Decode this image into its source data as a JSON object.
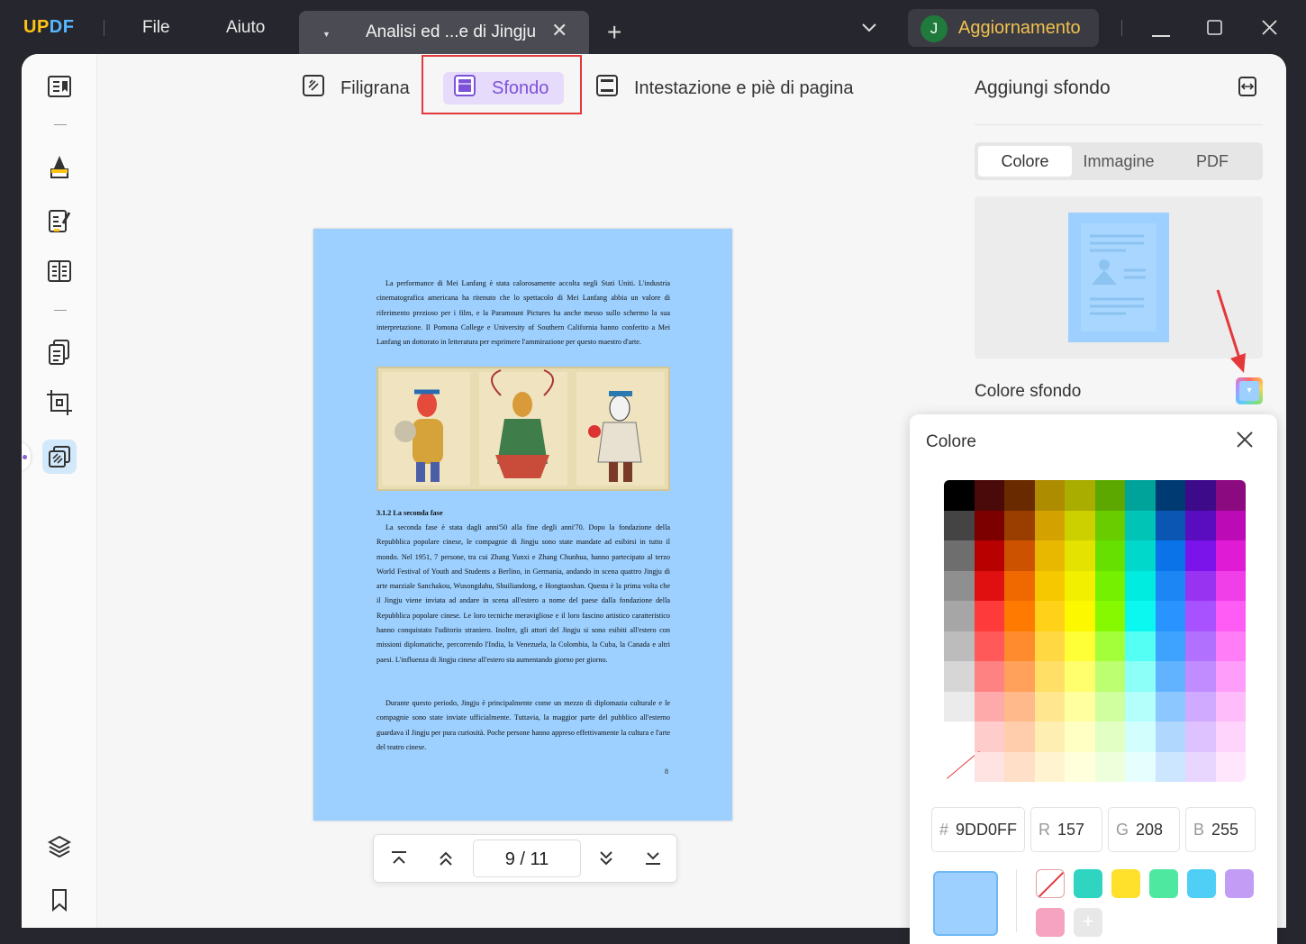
{
  "app": {
    "logo_u": "UP",
    "logo_df": "DF"
  },
  "menu": {
    "file": "File",
    "help": "Aiuto"
  },
  "tab": {
    "title": "Analisi ed ...e di Jingju",
    "close": "✕",
    "new": "+"
  },
  "account": {
    "avatar": "J",
    "upgrade": "Aggiornamento"
  },
  "toolbar": {
    "watermark": "Filigrana",
    "background": "Sfondo",
    "header_footer": "Intestazione e piè di pagina"
  },
  "document": {
    "para1": "La performance di Mei Lanfang è stata calorosamente accolta negli Stati Uniti. L'industria cinematografica americana ha ritenuto che lo spettacolo di Mei Lanfang abbia un valore di riferimento prezioso per i film, e la Paramount Pictures ha anche messo sullo schermo la sua interpretazione. Il Pomona College e University of Southern California hanno conferito a Mei Lanfang un dottorato in letteratura per esprimere l'ammirazione per questo maestro d'arte.",
    "heading": "3.1.2 La seconda fase",
    "para2": "La seconda fase è stata dagli anni'50 alla fine degli anni'70. Dopo la fondazione della Repubblica popolare cinese, le compagnie di Jingju sono state mandate ad esibirsi in tutto il mondo. Nel 1951, 7 persone, tra cui Zhang Yunxi e Zhang Chunhua, hanno partecipato al terzo World Festival of Youth and Students a Berlino, in Germania, andando in scena quattro Jingju di arte marziale Sanchakou, Wusongdahu, Shuiliandong, e Hongtaoshan. Questa è la prima volta che il Jingju viene inviata ad andare in scena all'estero a nome del paese dalla fondazione della Repubblica popolare cinese. Le loro tecniche meravigliose e il loro fascino artistico caratteristico hanno conquistato l'uditorio straniero. Inoltre, gli attori del Jingju si sono esibiti all'estero con missioni diplomatiche, percorrendo l'India, la Venezuela, la Colombia, la Cuba, la Canada e altri paesi. L'influenza di Jingju cinese all'estero sta aumentando giorno per giorno.",
    "para3": "Durante questo periodo, Jingju è principalmente come un mezzo di diplomazia culturale e le compagnie sono state inviate ufficialmente. Tuttavia, la maggior parte del pubblico all'esterno guardava il Jingju per pura curiosità. Poche persone hanno appreso effettivamente la cultura e l'arte del teatro cinese.",
    "page_number": "8",
    "background_color": "#9DD0FF"
  },
  "pager": {
    "current": "9",
    "separator": "/",
    "total": "11"
  },
  "panel": {
    "title": "Aggiungi sfondo",
    "tabs": [
      "Colore",
      "Immagine",
      "PDF"
    ],
    "active_tab": "Colore",
    "bg_color_label": "Colore sfondo"
  },
  "color_picker": {
    "title": "Colore",
    "hex_prefix": "#",
    "hex": "9DD0FF",
    "r_label": "R",
    "r": "157",
    "g_label": "G",
    "g": "208",
    "b_label": "B",
    "b": "255",
    "selected": "#9DD0FF",
    "palette": [
      [
        "#000000",
        "#4b0a0a",
        "#6a2a00",
        "#ad8c00",
        "#a8ad00",
        "#5da800",
        "#00a39a",
        "#003a73",
        "#3d0a8a",
        "#8c0a80"
      ],
      [
        "#444444",
        "#7c0000",
        "#9a3e00",
        "#d4a200",
        "#cdd000",
        "#68cc00",
        "#00c4b6",
        "#0b56b3",
        "#5a0dbf",
        "#bb0ab6"
      ],
      [
        "#6e6e6e",
        "#b80000",
        "#cc5200",
        "#e8b800",
        "#e3e200",
        "#66e000",
        "#00d8cb",
        "#0a73e8",
        "#7a14ea",
        "#df1bd6"
      ],
      [
        "#8f8f8f",
        "#e01010",
        "#f06800",
        "#f6c800",
        "#f2f000",
        "#74f000",
        "#00ece0",
        "#1c86f4",
        "#9933f2",
        "#f03ee8"
      ],
      [
        "#a6a6a6",
        "#ff3a3a",
        "#ff7a00",
        "#ffd118",
        "#fbf800",
        "#86f800",
        "#0af8ef",
        "#2994ff",
        "#a751ff",
        "#ff5cf5"
      ],
      [
        "#bcbcbc",
        "#ff5959",
        "#ff8b2e",
        "#ffd842",
        "#ffff38",
        "#a2ff3a",
        "#54fff4",
        "#3ea2ff",
        "#b270ff",
        "#ff7df7"
      ],
      [
        "#d6d6d6",
        "#ff8282",
        "#ffa15a",
        "#ffdf66",
        "#ffff6e",
        "#bcff70",
        "#8cfff9",
        "#62b3ff",
        "#c08cff",
        "#ff9dfa"
      ],
      [
        "#ebebeb",
        "#ffaaaa",
        "#ffb98a",
        "#ffe68f",
        "#ffffa0",
        "#d0ffa0",
        "#b4fffb",
        "#8cc7ff",
        "#d0aaff",
        "#ffbcfb"
      ],
      [
        "#ffffff",
        "#ffcccc",
        "#ffcdac",
        "#ffeeb2",
        "#ffffc4",
        "#e2ffc4",
        "#d2fffd",
        "#b0d8ff",
        "#ddc2ff",
        "#ffd4fc"
      ],
      [
        "none",
        "#ffe3e3",
        "#ffdfc8",
        "#fff4cf",
        "#ffffdc",
        "#eeffdc",
        "#e6fffe",
        "#cce6ff",
        "#e8d6ff",
        "#ffe6fd"
      ]
    ],
    "recent": [
      "none",
      "#2fd5c0",
      "#ffe02a",
      "#4fe8a0",
      "#4fcff5",
      "#c39df5",
      "#f5a3c0",
      "add"
    ]
  }
}
